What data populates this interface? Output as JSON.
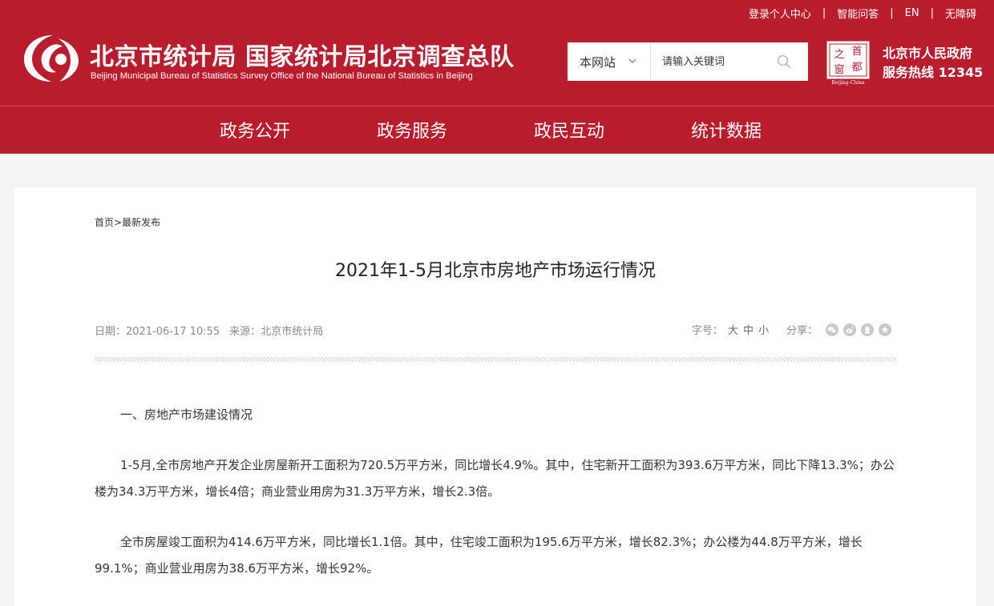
{
  "top_links": [
    "登录个人中心",
    "智能问答",
    "EN",
    "无障碍"
  ],
  "top_links_separator": "|",
  "site": {
    "title": "北京市统计局 国家统计局北京调查总队",
    "subtitle": "Beijing Municipal Bureau of Statistics  Survey Office of the National Bureau of Statistics in Beijing"
  },
  "search": {
    "scope": "本网站",
    "placeholder": "请输入关键词"
  },
  "capital_logo": {
    "chars": [
      "之",
      "首",
      "都",
      "窗"
    ],
    "caption": "Beijing-China"
  },
  "gov": {
    "name": "北京市人民政府",
    "hotline": "服务热线 12345"
  },
  "nav": [
    "政务公开",
    "政务服务",
    "政民互动",
    "统计数据"
  ],
  "breadcrumb": {
    "home": "首页",
    "separator": ">",
    "current": "最新发布"
  },
  "article": {
    "title": "2021年1-5月北京市房地产市场运行情况",
    "date_label": "日期：",
    "date": "2021-06-17 10:55",
    "source_label": "来源：",
    "source": "北京市统计局",
    "font_label": "字号：",
    "font_sizes": [
      "大",
      "中",
      "小"
    ],
    "share_label": "分享：",
    "paragraphs": [
      "一、房地产市场建设情况",
      "1-5月,全市房地产开发企业房屋新开工面积为720.5万平方米，同比增长4.9%。其中，住宅新开工面积为393.6万平方米，同比下降13.3%；办公楼为34.3万平方米，增长4倍；商业营业用房为31.3万平方米，增长2.3倍。",
      "全市房屋竣工面积为414.6万平方米，同比增长1.1倍。其中，住宅竣工面积为195.6万平方米，增长82.3%；办公楼为44.8万平方米，增长99.1%；商业营业用房为38.6万平方米，增长92%。"
    ]
  },
  "colors": {
    "brand_red": "#b91c2d",
    "page_bg": "#f4f4f4"
  }
}
